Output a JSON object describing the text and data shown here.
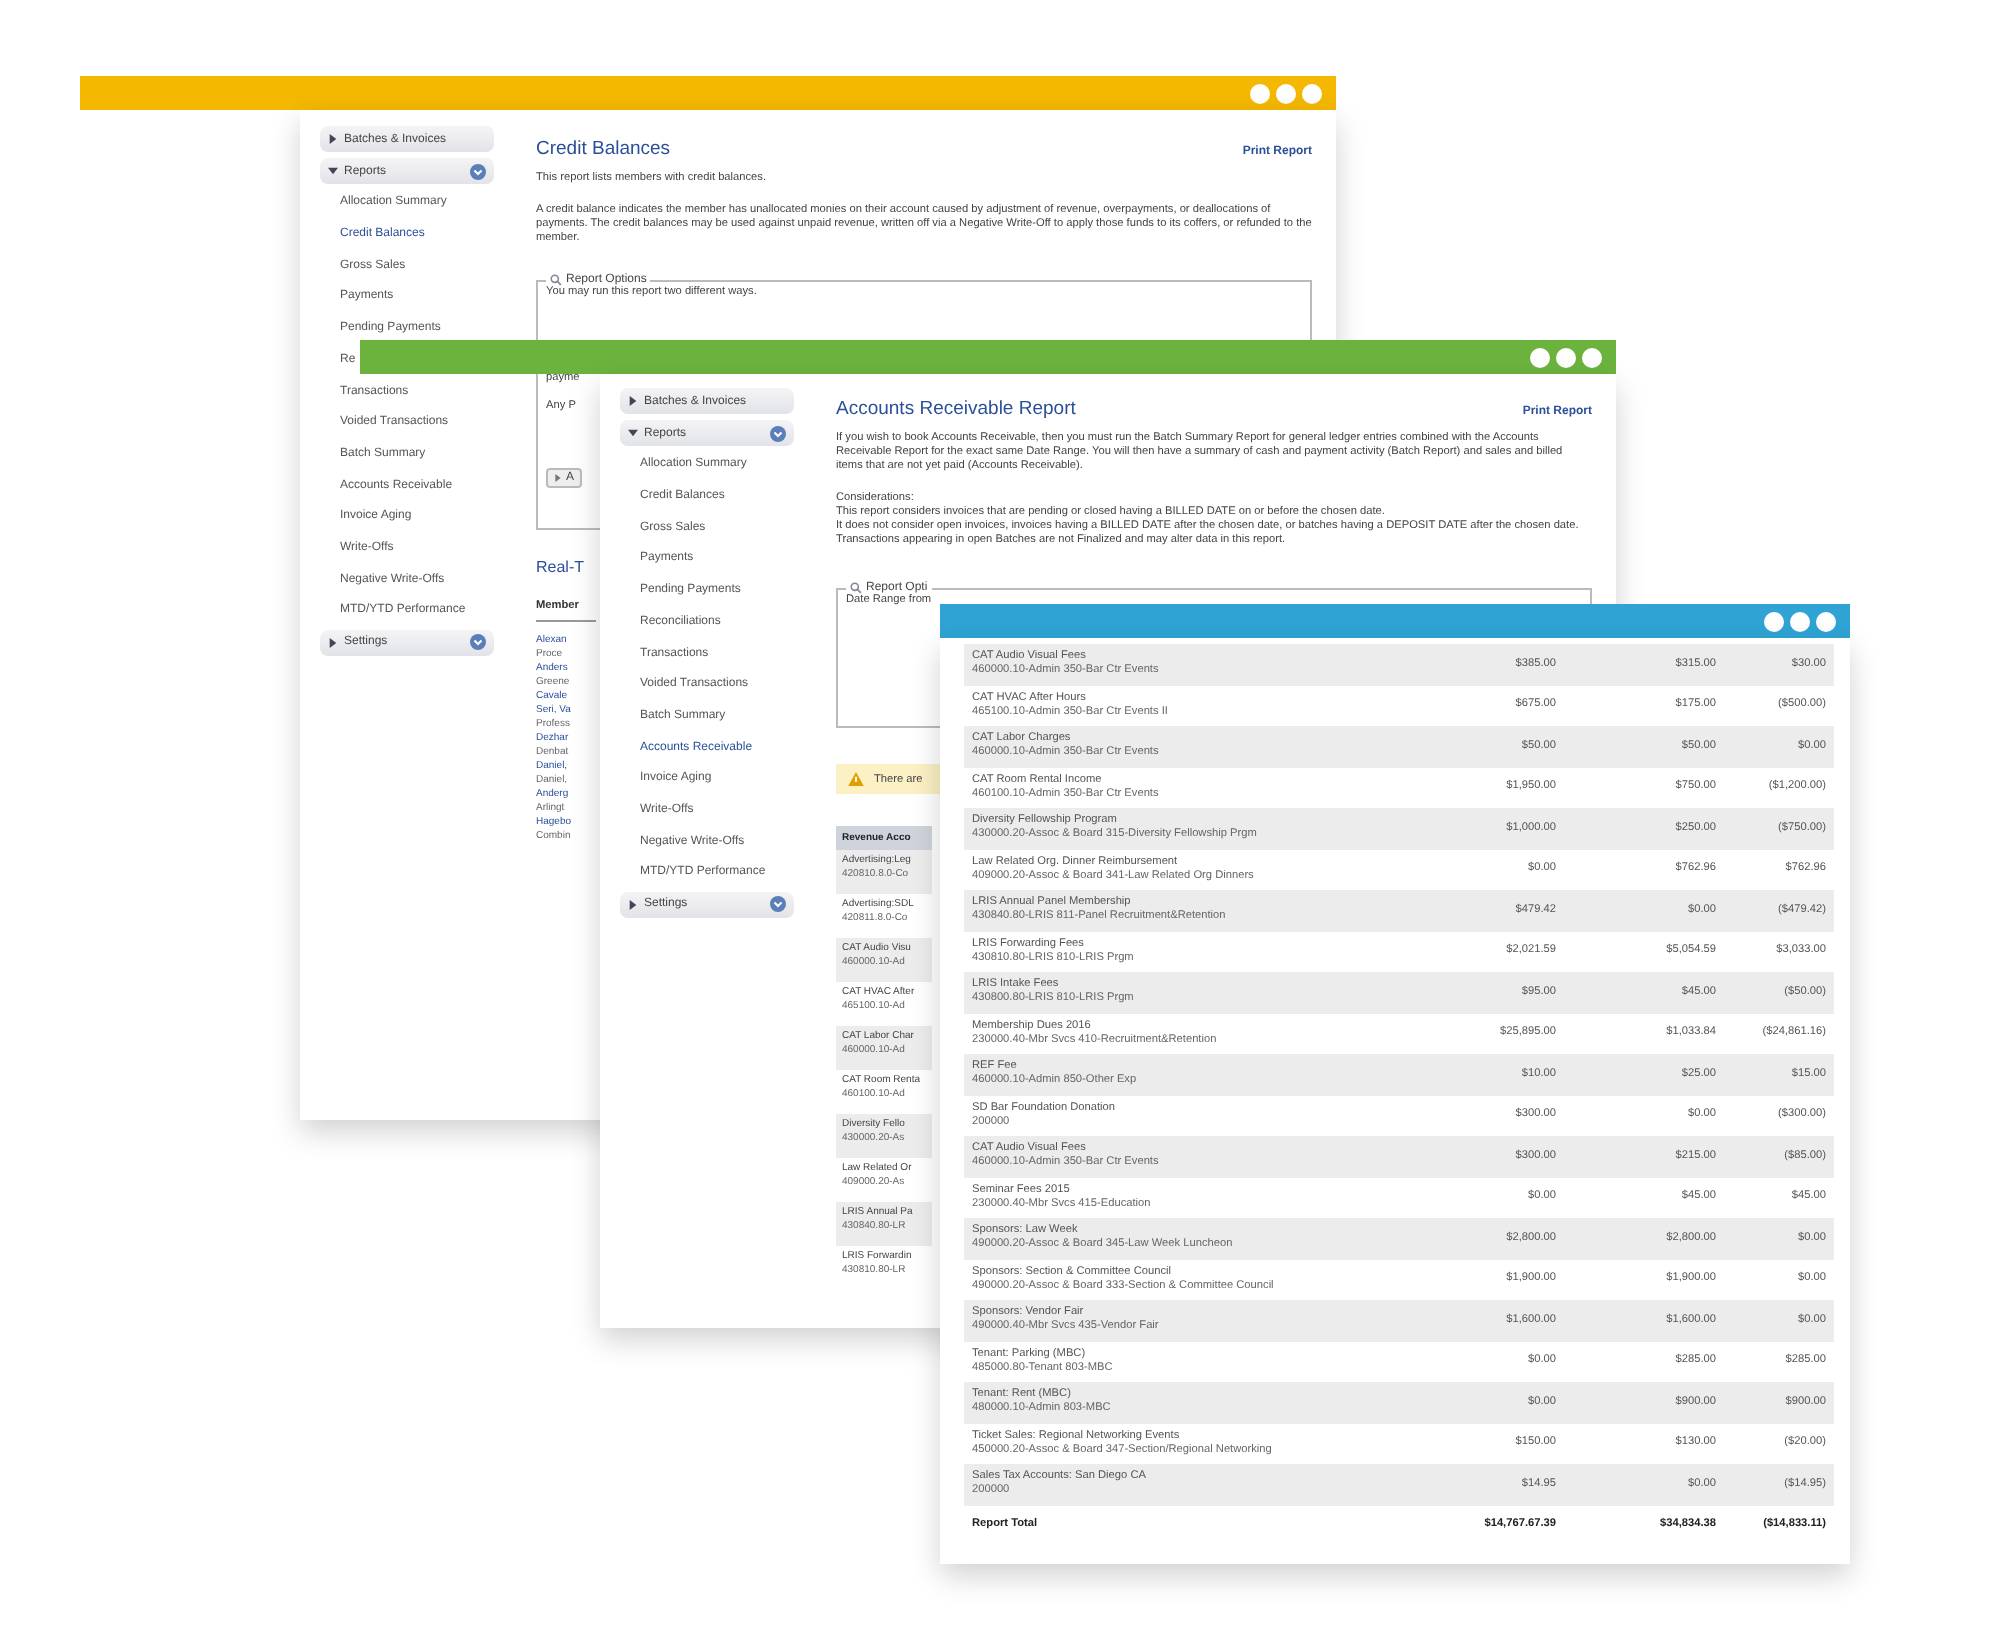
{
  "windows": [
    {
      "kind": "report",
      "color": "#f4b800",
      "title": "Credit Balances",
      "print_link": "Print Report",
      "sidebar": [
        {
          "kind": "group",
          "label": "Batches & Invoices",
          "expanded": false
        },
        {
          "kind": "group",
          "label": "Reports",
          "expanded": true
        },
        {
          "kind": "link",
          "label": "Allocation Summary",
          "selected": false
        },
        {
          "kind": "link",
          "label": "Credit Balances",
          "selected": true
        },
        {
          "kind": "link",
          "label": "Gross Sales",
          "selected": false
        },
        {
          "kind": "link",
          "label": "Payments",
          "selected": false
        },
        {
          "kind": "link",
          "label": "Pending Payments",
          "selected": false
        },
        {
          "kind": "link",
          "label": "Re",
          "selected": false
        },
        {
          "kind": "link",
          "label": "Transactions",
          "selected": false
        },
        {
          "kind": "link",
          "label": "Voided Transactions",
          "selected": false
        },
        {
          "kind": "link",
          "label": "Batch Summary",
          "selected": false
        },
        {
          "kind": "link",
          "label": "Accounts Receivable",
          "selected": false
        },
        {
          "kind": "link",
          "label": "Invoice Aging",
          "selected": false
        },
        {
          "kind": "link",
          "label": "Write-Offs",
          "selected": false
        },
        {
          "kind": "link",
          "label": "Negative Write-Offs",
          "selected": false
        },
        {
          "kind": "link",
          "label": "MTD/YTD Performance",
          "selected": false
        },
        {
          "kind": "group",
          "label": "Settings",
          "expanded": false
        }
      ],
      "paragraphs": [
        "This report lists members with credit balances.",
        "A credit balance indicates the member has unallocated monies on their account caused by adjustment of revenue, overpayments, or deallocations of payments. The credit balances may be used against unpaid revenue, written off via a Negative Write-Off to apply those funds to its coffers, or refunded to the member."
      ],
      "options": {
        "legend": "Report Options",
        "lines": [
          "You may run this report two different ways."
        ],
        "partial_lines": [
          "payme",
          "Any P"
        ],
        "button": "A"
      },
      "section_title": "Real-T",
      "list_header": "Member",
      "list": [
        {
          "kind": "member",
          "name": "Alexan",
          "detail": "Proce"
        },
        {
          "kind": "member",
          "name": "Anders",
          "detail": "Greene"
        },
        {
          "kind": "member",
          "name": "Cavale"
        },
        {
          "kind": "member",
          "name": "Seri, Va",
          "detail": "Profess"
        },
        {
          "kind": "member",
          "name": "Dezhar",
          "detail": "Denbat"
        },
        {
          "kind": "member",
          "name": "Daniel,",
          "detail": "Daniel,"
        },
        {
          "kind": "member",
          "name": "Anderg",
          "detail": "Arlingt"
        },
        {
          "kind": "member",
          "name": "Hagebo",
          "detail": "Combin"
        }
      ]
    },
    {
      "kind": "report",
      "color": "#6cb33e",
      "title": "Accounts Receivable Report",
      "print_link": "Print Report",
      "sidebar": [
        {
          "kind": "group",
          "label": "Batches & Invoices",
          "expanded": false
        },
        {
          "kind": "group",
          "label": "Reports",
          "expanded": true
        },
        {
          "kind": "link",
          "label": "Allocation Summary",
          "selected": false
        },
        {
          "kind": "link",
          "label": "Credit Balances",
          "selected": false
        },
        {
          "kind": "link",
          "label": "Gross Sales",
          "selected": false
        },
        {
          "kind": "link",
          "label": "Payments",
          "selected": false
        },
        {
          "kind": "link",
          "label": "Pending Payments",
          "selected": false
        },
        {
          "kind": "link",
          "label": "Reconciliations",
          "selected": false
        },
        {
          "kind": "link",
          "label": "Transactions",
          "selected": false
        },
        {
          "kind": "link",
          "label": "Voided Transactions",
          "selected": false
        },
        {
          "kind": "link",
          "label": "Batch Summary",
          "selected": false
        },
        {
          "kind": "link",
          "label": "Accounts Receivable",
          "selected": true
        },
        {
          "kind": "link",
          "label": "Invoice Aging",
          "selected": false
        },
        {
          "kind": "link",
          "label": "Write-Offs",
          "selected": false
        },
        {
          "kind": "link",
          "label": "Negative Write-Offs",
          "selected": false
        },
        {
          "kind": "link",
          "label": "MTD/YTD Performance",
          "selected": false
        },
        {
          "kind": "group",
          "label": "Settings",
          "expanded": false
        }
      ],
      "paragraphs": [
        "If you wish to book Accounts Receivable, then you must run the Batch Summary Report for general ledger entries combined with the Accounts Receivable Report for the exact same Date Range. You will then have a summary of cash and payment activity (Batch Report) and sales and billed items that are not yet paid (Accounts Receivable)."
      ],
      "considerations": {
        "heading": "Considerations:",
        "lines": [
          "This report considers invoices that are pending or closed having a BILLED DATE on or before the chosen date.",
          "It does not consider open invoices, invoices having a BILLED DATE after the chosen date, or batches having a DEPOSIT DATE after the chosen date. Transactions appearing in open Batches are not Finalized and may alter data in this report."
        ]
      },
      "options": {
        "legend": "Report Opti",
        "lines": [
          "Date Range from"
        ]
      },
      "warning": "There are",
      "list_header": "Revenue Acco",
      "list": [
        {
          "kind": "revenue",
          "name": "Advertising:Leg",
          "detail": "420810.8.0-Co"
        },
        {
          "kind": "revenue",
          "name": "Advertising:SDL",
          "detail": "420811.8.0-Co"
        },
        {
          "kind": "revenue",
          "name": "CAT Audio Visu",
          "detail": "460000.10-Ad"
        },
        {
          "kind": "revenue",
          "name": "CAT HVAC After",
          "detail": "465100.10-Ad"
        },
        {
          "kind": "revenue",
          "name": "CAT Labor Char",
          "detail": "460000.10-Ad"
        },
        {
          "kind": "revenue",
          "name": "CAT Room Renta",
          "detail": "460100.10-Ad"
        },
        {
          "kind": "revenue",
          "name": "Diversity Fello",
          "detail": "430000.20-As"
        },
        {
          "kind": "revenue",
          "name": "Law Related Or",
          "detail": "409000.20-As"
        },
        {
          "kind": "revenue",
          "name": "LRIS Annual Pa",
          "detail": "430840.80-LR"
        },
        {
          "kind": "revenue",
          "name": "LRIS Forwardin",
          "detail": "430810.80-LR"
        }
      ]
    },
    {
      "kind": "table",
      "color": "#2fa3d4",
      "rows": [
        {
          "name": "CAT Audio Visual Fees",
          "code": "460000.10-Admin 350-Bar Ctr Events",
          "amounts": [
            "$385.00",
            "$315.00",
            "$30.00"
          ]
        },
        {
          "name": "CAT HVAC After Hours",
          "code": "465100.10-Admin 350-Bar Ctr Events II",
          "amounts": [
            "$675.00",
            "$175.00",
            "($500.00)"
          ]
        },
        {
          "name": "CAT Labor Charges",
          "code": "460000.10-Admin 350-Bar Ctr Events",
          "amounts": [
            "$50.00",
            "$50.00",
            "$0.00"
          ]
        },
        {
          "name": "CAT Room Rental Income",
          "code": "460100.10-Admin 350-Bar Ctr Events",
          "amounts": [
            "$1,950.00",
            "$750.00",
            "($1,200.00)"
          ]
        },
        {
          "name": "Diversity Fellowship Program",
          "code": "430000.20-Assoc & Board 315-Diversity Fellowship Prgm",
          "amounts": [
            "$1,000.00",
            "$250.00",
            "($750.00)"
          ]
        },
        {
          "name": "Law Related Org. Dinner Reimbursement",
          "code": "409000.20-Assoc & Board 341-Law Related Org Dinners",
          "amounts": [
            "$0.00",
            "$762.96",
            "$762.96"
          ]
        },
        {
          "name": "LRIS Annual Panel Membership",
          "code": "430840.80-LRIS 811-Panel Recruitment&Retention",
          "amounts": [
            "$479.42",
            "$0.00",
            "($479.42)"
          ]
        },
        {
          "name": "LRIS Forwarding Fees",
          "code": "430810.80-LRIS 810-LRIS Prgm",
          "amounts": [
            "$2,021.59",
            "$5,054.59",
            "$3,033.00"
          ]
        },
        {
          "name": "LRIS Intake Fees",
          "code": "430800.80-LRIS 810-LRIS Prgm",
          "amounts": [
            "$95.00",
            "$45.00",
            "($50.00)"
          ]
        },
        {
          "name": "Membership Dues 2016",
          "code": "230000.40-Mbr Svcs 410-Recruitment&Retention",
          "amounts": [
            "$25,895.00",
            "$1,033.84",
            "($24,861.16)"
          ]
        },
        {
          "name": "REF Fee",
          "code": "460000.10-Admin 850-Other Exp",
          "amounts": [
            "$10.00",
            "$25.00",
            "$15.00"
          ]
        },
        {
          "name": "SD Bar Foundation Donation",
          "code": "200000",
          "amounts": [
            "$300.00",
            "$0.00",
            "($300.00)"
          ]
        },
        {
          "name": "CAT Audio Visual Fees",
          "code": "460000.10-Admin 350-Bar Ctr Events",
          "amounts": [
            "$300.00",
            "$215.00",
            "($85.00)"
          ]
        },
        {
          "name": "Seminar Fees 2015",
          "code": "230000.40-Mbr Svcs 415-Education",
          "amounts": [
            "$0.00",
            "$45.00",
            "$45.00"
          ]
        },
        {
          "name": "Sponsors: Law Week",
          "code": "490000.20-Assoc & Board 345-Law Week Luncheon",
          "amounts": [
            "$2,800.00",
            "$2,800.00",
            "$0.00"
          ]
        },
        {
          "name": "Sponsors: Section & Committee Council",
          "code": "490000.20-Assoc & Board 333-Section & Committee Council",
          "amounts": [
            "$1,900.00",
            "$1,900.00",
            "$0.00"
          ]
        },
        {
          "name": "Sponsors: Vendor Fair",
          "code": "490000.40-Mbr Svcs 435-Vendor Fair",
          "amounts": [
            "$1,600.00",
            "$1,600.00",
            "$0.00"
          ]
        },
        {
          "name": "Tenant: Parking (MBC)",
          "code": "485000.80-Tenant 803-MBC",
          "amounts": [
            "$0.00",
            "$285.00",
            "$285.00"
          ]
        },
        {
          "name": "Tenant: Rent (MBC)",
          "code": "480000.10-Admin 803-MBC",
          "amounts": [
            "$0.00",
            "$900.00",
            "$900.00"
          ]
        },
        {
          "name": "Ticket Sales: Regional Networking Events",
          "code": "450000.20-Assoc & Board 347-Section/Regional Networking",
          "amounts": [
            "$150.00",
            "$130.00",
            "($20.00)"
          ]
        },
        {
          "name": "Sales Tax Accounts: San Diego CA",
          "code": "200000",
          "amounts": [
            "$14.95",
            "$0.00",
            "($14.95)"
          ]
        }
      ],
      "total": {
        "label": "Report Total",
        "amounts": [
          "$14,767.67.39",
          "$34,834.38",
          "($14,833.11)"
        ]
      }
    }
  ]
}
